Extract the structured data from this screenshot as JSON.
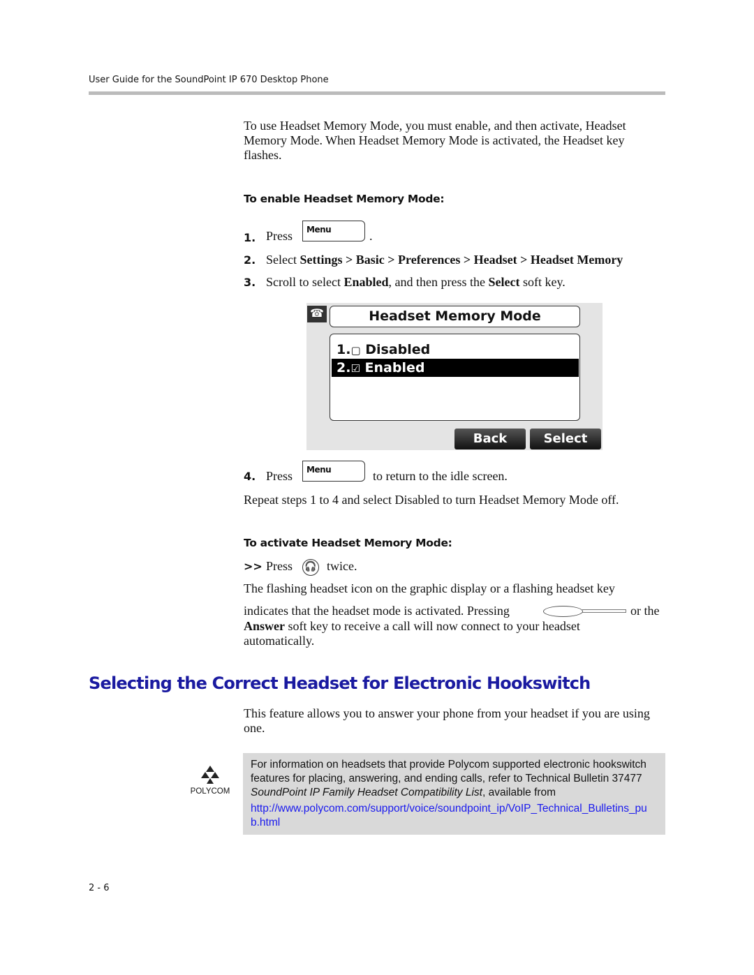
{
  "header": {
    "running_title": "User Guide for the SoundPoint IP 670 Desktop Phone"
  },
  "intro": "To use Headset Memory Mode, you must enable, and then activate, Headset Memory Mode. When Headset Memory Mode is activated, the Headset key flashes.",
  "enable": {
    "heading": "To enable Headset Memory Mode:",
    "steps": [
      {
        "num": "1.",
        "pre": "Press",
        "key": "Menu",
        "post": "."
      },
      {
        "num": "2.",
        "pre": "Select",
        "path": [
          "Settings",
          "Basic",
          "Preferences",
          "Headset",
          "Headset Memory"
        ],
        "sep": ">"
      },
      {
        "num": "3.",
        "pre": "Scroll to select",
        "b1": "Enabled",
        "mid": ", and then press the",
        "b2": "Select",
        "post": "soft key."
      },
      {
        "num": "4.",
        "pre": "Press",
        "key": "Menu",
        "post": "to return to the idle screen."
      }
    ],
    "repeat": "Repeat steps 1 to 4 and select Disabled to turn Headset Memory Mode off."
  },
  "screen": {
    "title": "Headset Memory Mode",
    "options": [
      {
        "label": "1.",
        "text": "Disabled",
        "checked": false,
        "selected": false
      },
      {
        "label": "2.",
        "text": "Enabled",
        "checked": true,
        "selected": true
      }
    ],
    "softkeys": [
      "Back",
      "Select"
    ]
  },
  "activate": {
    "heading": "To activate Headset Memory Mode:",
    "bullet": ">>",
    "pre": "Press",
    "post": "twice.",
    "para1": "The flashing headset icon on the graphic display or a flashing headset key",
    "para2a": "indicates that the headset mode is activated. Pressing",
    "para2b": "or the",
    "para3b": "Answer",
    "para3": "soft key to receive a call will now connect to your headset",
    "para4": "automatically."
  },
  "section": {
    "title": "Selecting the Correct Headset for Electronic Hookswitch",
    "text": "This feature allows you to answer your phone from your headset if you are using one."
  },
  "note": {
    "logo": "POLYCOM",
    "l1": "For information on headsets that provide Polycom supported electronic hookswitch",
    "l2": "features for placing, answering, and ending calls, refer to Technical Bulletin 37477",
    "l3i": "SoundPoint IP Family Headset Compatibility List",
    "l3": ", available from",
    "link1": "http://www.polycom.com/support/voice/soundpoint_ip/VoIP_Technical_Bulletins_pu",
    "link2": "b.html",
    "link_color": "#1a1aee"
  },
  "footer": {
    "page": "2 - 6"
  }
}
